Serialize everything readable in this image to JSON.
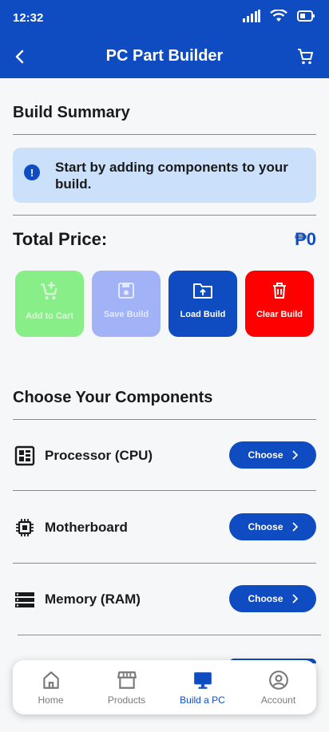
{
  "status_bar": {
    "time": "12:32"
  },
  "header": {
    "title": "PC Part Builder"
  },
  "summary": {
    "title": "Build Summary",
    "alert_text": "Start by adding components to your build.",
    "total_label": "Total Price:",
    "total_value": "₱0"
  },
  "actions": {
    "add_to_cart": "Add to Cart",
    "save_build": "Save Build",
    "load_build": "Load Build",
    "clear_build": "Clear Build"
  },
  "components": {
    "title": "Choose Your Components",
    "items": [
      {
        "label": "Processor (CPU)",
        "button": "Choose",
        "icon": "cpu-icon"
      },
      {
        "label": "Motherboard",
        "button": "Choose",
        "icon": "motherboard-icon"
      },
      {
        "label": "Memory (RAM)",
        "button": "Choose",
        "icon": "ram-icon"
      }
    ]
  },
  "nav": {
    "items": [
      {
        "label": "Home",
        "icon": "home-icon"
      },
      {
        "label": "Products",
        "icon": "store-icon"
      },
      {
        "label": "Build a PC",
        "icon": "monitor-icon"
      },
      {
        "label": "Account",
        "icon": "account-icon"
      }
    ],
    "active": "Build a PC"
  },
  "colors": {
    "primary": "#0f4cc2",
    "alert_bg": "#cbe0fb",
    "add_to_cart_bg": "#88ee88",
    "save_build_bg": "#a2b2f7",
    "clear_build_bg": "#ff0000"
  }
}
